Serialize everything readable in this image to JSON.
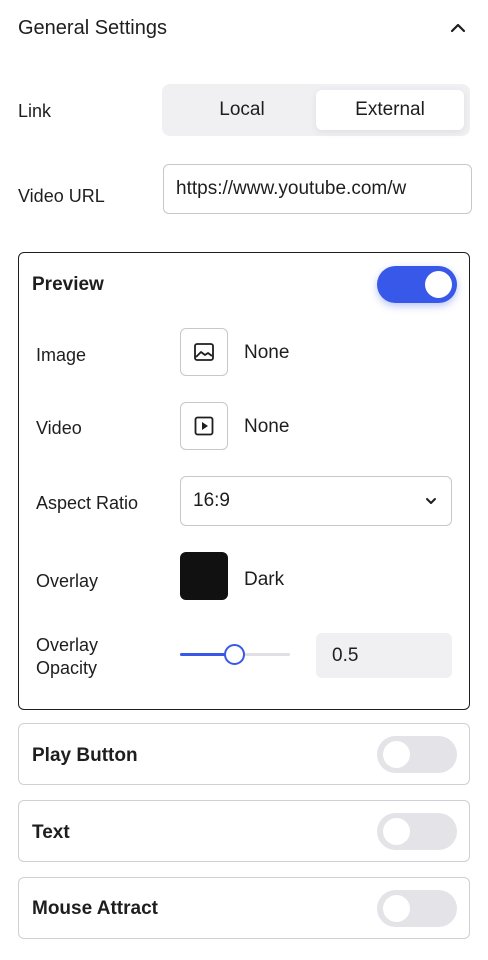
{
  "header": {
    "title": "General Settings",
    "chevron_icon": "chevron-up-icon"
  },
  "link": {
    "label": "Link",
    "options": [
      "Local",
      "External"
    ],
    "selected": "External"
  },
  "video_url": {
    "label": "Video URL",
    "value": "https://www.youtube.com/w"
  },
  "preview": {
    "title": "Preview",
    "enabled": true,
    "image": {
      "label": "Image",
      "icon": "image-icon",
      "value": "None"
    },
    "video": {
      "label": "Video",
      "icon": "video-play-icon",
      "value": "None"
    },
    "aspect_ratio": {
      "label": "Aspect Ratio",
      "value": "16:9"
    },
    "overlay": {
      "label": "Overlay",
      "value": "Dark",
      "color": "#111111"
    },
    "overlay_opacity": {
      "label_line1": "Overlay",
      "label_line2": "Opacity",
      "value": "0.5",
      "fraction": 0.5
    }
  },
  "play_button": {
    "title": "Play Button",
    "enabled": false
  },
  "text_section": {
    "title": "Text",
    "enabled": false
  },
  "mouse_attract": {
    "title": "Mouse Attract",
    "enabled": false
  },
  "colors": {
    "accent": "#3858e9",
    "toggle_off": "#e3e3e8",
    "text": "#1e1e1e"
  }
}
